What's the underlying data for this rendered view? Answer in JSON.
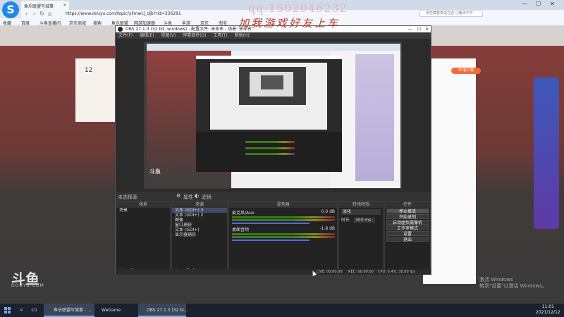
{
  "browser": {
    "tab_title": "鱼乐联盟写城事",
    "url": "https://www.douyu.com/topic/yllmwcj_djb?rid=336281",
    "search_placeholder": "那些藏着英语在说 小鹿世平中",
    "bookmarks": [
      "收藏",
      "百度",
      "斗鱼直播间",
      "京东商城",
      "搜索",
      "鱼乐联盟",
      "网游加速器",
      "斗鱼",
      "手游",
      "京东",
      "淘宝"
    ],
    "controls": [
      "—",
      "☐",
      "✕"
    ]
  },
  "watermarks": {
    "qq": "qq:1502046232",
    "slogan": "加我游戏好友上车"
  },
  "page": {
    "count": "12",
    "pc_button": "PC客户端",
    "logo": "斗鱼",
    "logo_sub": "DOUYU.COM",
    "activate_line1": "激活 Windows",
    "activate_line2": "转到\"设置\"以激活 Windows。"
  },
  "obs": {
    "title": "OBS 27.1.3 (32 bit, windows) - 配置文件: 未命名 - 场景: 未命名",
    "menu": [
      "文件(F)",
      "编辑(E)",
      "视图(V)",
      "停靠部件(D)",
      "工具(T)",
      "帮助(H)"
    ],
    "nested_douyu": "斗鱼",
    "toolbar_label": "未选择源",
    "toolbar_props": "属性",
    "toolbar_filters": "滤镜",
    "docks": {
      "scenes": {
        "title": "场景",
        "items": [
          "场景"
        ]
      },
      "sources": {
        "title": "来源",
        "items": [
          "文本 (GDI+) 3",
          "文本 (GDI+) 2",
          "图像",
          "窗口捕获",
          "文本 (GDI+)",
          "显示器捕获"
        ]
      },
      "mixer": {
        "title": "混音器",
        "tracks": [
          {
            "name": "麦克风/Aux",
            "db": "0.0 dB"
          },
          {
            "name": "桌面音频",
            "db": "-1.8 dB"
          }
        ]
      },
      "transitions": {
        "title": "转场特效",
        "type": "淡化",
        "duration_label": "时长",
        "duration": "300 ms"
      },
      "controls": {
        "title": "控件",
        "buttons": [
          "停止推流",
          "开始录制",
          "启动虚拟摄像机",
          "工作室模式",
          "设置",
          "退出"
        ]
      }
    },
    "status": {
      "live": "LIVE: 00:00:00",
      "rec": "REC: 00:00:00",
      "cpu": "CPU: 0.4%, 30.00 fps"
    }
  },
  "taskbar": {
    "items": [
      "鱼乐联盟写城事 - ...",
      "WeGame",
      "OBS 27.1.3 (32 bi..."
    ],
    "time": "11:01",
    "date": "2021/12/12"
  }
}
